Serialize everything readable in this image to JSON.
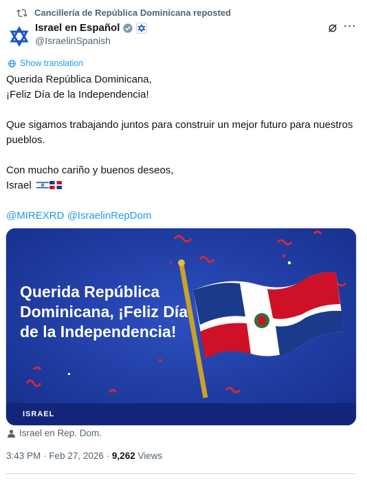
{
  "repost": {
    "label": "Cancillería de República Dominicana reposted"
  },
  "author": {
    "name": "Israel en Español",
    "handle": "@IsraelinSpanish"
  },
  "translate": {
    "label": "Show translation"
  },
  "post": {
    "line1": "Querida República Dominicana,",
    "line2": "¡Feliz Día de la Independencia!",
    "line3": "Que sigamos trabajando juntos para construir un mejor futuro para nuestros pueblos.",
    "line4": "Con mucho cariño y buenos deseos,",
    "line5": "Israel",
    "mention1": "@MIREXRD",
    "mention2": "@IsraelinRepDom"
  },
  "media": {
    "title": "Querida República Dominicana, ¡Feliz Día de la Independencia!",
    "logo": "ISRAEL"
  },
  "attribution": {
    "label": "Israel en Rep. Dom."
  },
  "meta": {
    "time": "3:43 PM",
    "date": "Feb 27, 2026",
    "views_count": "9,262",
    "views_label": "Views"
  },
  "colors": {
    "accent": "#1d9bf0",
    "muted": "#536471",
    "text": "#0f1419",
    "media_bg": "#1f3a9e"
  }
}
